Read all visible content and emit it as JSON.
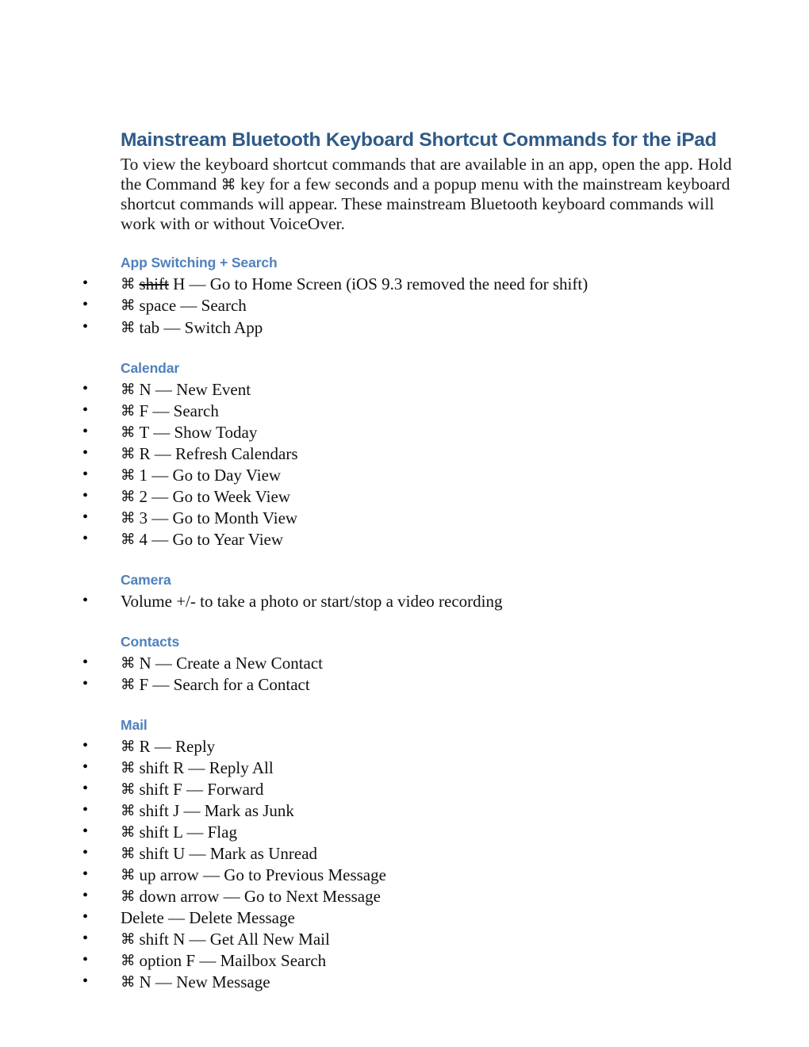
{
  "document": {
    "title": "Mainstream Bluetooth Keyboard Shortcut Commands for the iPad",
    "intro_part1": "To view the keyboard shortcut commands that are available in an app, open the app. Hold the Command ",
    "intro_cmd_symbol": "⌘",
    "intro_part2": " key for a few seconds and a popup menu with the mainstream keyboard shortcut commands will appear.  These mainstream Bluetooth keyboard commands will work with or without VoiceOver.",
    "command_symbol": "⌘",
    "title_color": "#2F5A87",
    "heading_color": "#4F81BD",
    "body_color": "#111111"
  },
  "sections": [
    {
      "heading": "App Switching + Search",
      "items": [
        {
          "cmd": true,
          "strikethrough_text": "shift",
          "text": " H — Go to Home Screen (iOS 9.3 removed the need for shift)"
        },
        {
          "cmd": true,
          "text": "space — Search"
        },
        {
          "cmd": true,
          "text": "tab — Switch App"
        }
      ]
    },
    {
      "heading": "Calendar",
      "items": [
        {
          "cmd": true,
          "text": "N — New Event"
        },
        {
          "cmd": true,
          "text": "F — Search"
        },
        {
          "cmd": true,
          "text": "T — Show Today"
        },
        {
          "cmd": true,
          "text": "R — Refresh Calendars"
        },
        {
          "cmd": true,
          "text": "1 — Go to Day View"
        },
        {
          "cmd": true,
          "text": "2 — Go to Week View"
        },
        {
          "cmd": true,
          "text": "3 — Go to Month View"
        },
        {
          "cmd": true,
          "text": "4 — Go to Year View"
        }
      ]
    },
    {
      "heading": "Camera",
      "items": [
        {
          "cmd": false,
          "text": "Volume +/- to take a photo or start/stop a video recording"
        }
      ]
    },
    {
      "heading": "Contacts",
      "items": [
        {
          "cmd": true,
          "text": "N — Create a New Contact"
        },
        {
          "cmd": true,
          "text": "F — Search for a Contact"
        }
      ]
    },
    {
      "heading": "Mail",
      "items": [
        {
          "cmd": true,
          "text": "R — Reply"
        },
        {
          "cmd": true,
          "text": "shift R — Reply All"
        },
        {
          "cmd": true,
          "text": "shift F — Forward"
        },
        {
          "cmd": true,
          "text": "shift J — Mark as Junk"
        },
        {
          "cmd": true,
          "text": "shift L — Flag"
        },
        {
          "cmd": true,
          "text": "shift U — Mark as Unread"
        },
        {
          "cmd": true,
          "text": "up arrow — Go to Previous Message"
        },
        {
          "cmd": true,
          "text": "down arrow — Go to Next Message"
        },
        {
          "cmd": false,
          "text": "Delete — Delete Message"
        },
        {
          "cmd": true,
          "text": "shift N — Get All New Mail"
        },
        {
          "cmd": true,
          "text": "option F — Mailbox Search"
        },
        {
          "cmd": true,
          "text": "N — New Message"
        }
      ]
    }
  ]
}
